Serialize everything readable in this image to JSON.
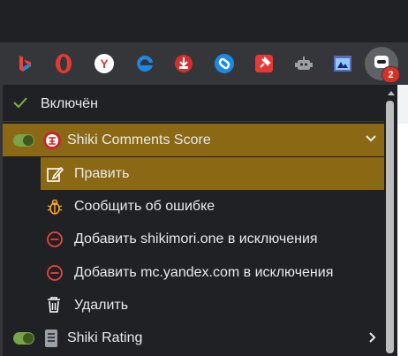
{
  "toolbar": {
    "extensions": [
      {
        "icon": "bing-icon"
      },
      {
        "icon": "opera-icon"
      },
      {
        "icon": "yandex-icon"
      },
      {
        "icon": "edge-icon"
      },
      {
        "icon": "download-icon"
      },
      {
        "icon": "shazam-icon"
      },
      {
        "icon": "pin-icon"
      },
      {
        "icon": "robot-icon"
      },
      {
        "icon": "puzzle-window-icon"
      }
    ],
    "active_extension": {
      "icon": "shiki-extension-icon",
      "badge": "2"
    }
  },
  "menu": {
    "enabled_label": "Включён",
    "extension": {
      "name": "Shiki Comments Score",
      "toggle_on": true
    },
    "items": [
      {
        "label": "Править",
        "icon": "edit-icon"
      },
      {
        "label": "Сообщить об ошибке",
        "icon": "bug-icon"
      },
      {
        "label": "Добавить shikimori.one в исключения",
        "icon": "block-icon"
      },
      {
        "label": "Добавить mc.yandex.com в исключения",
        "icon": "block-icon"
      },
      {
        "label": "Удалить",
        "icon": "trash-icon"
      }
    ],
    "next_extension": {
      "name": "Shiki Rating",
      "toggle_on": true
    }
  },
  "colors": {
    "accent_highlight": "#8b6914",
    "toggle_on": "#7aa34a",
    "check": "#7cb342",
    "block_red": "#e8453c",
    "badge": "#d93025"
  }
}
